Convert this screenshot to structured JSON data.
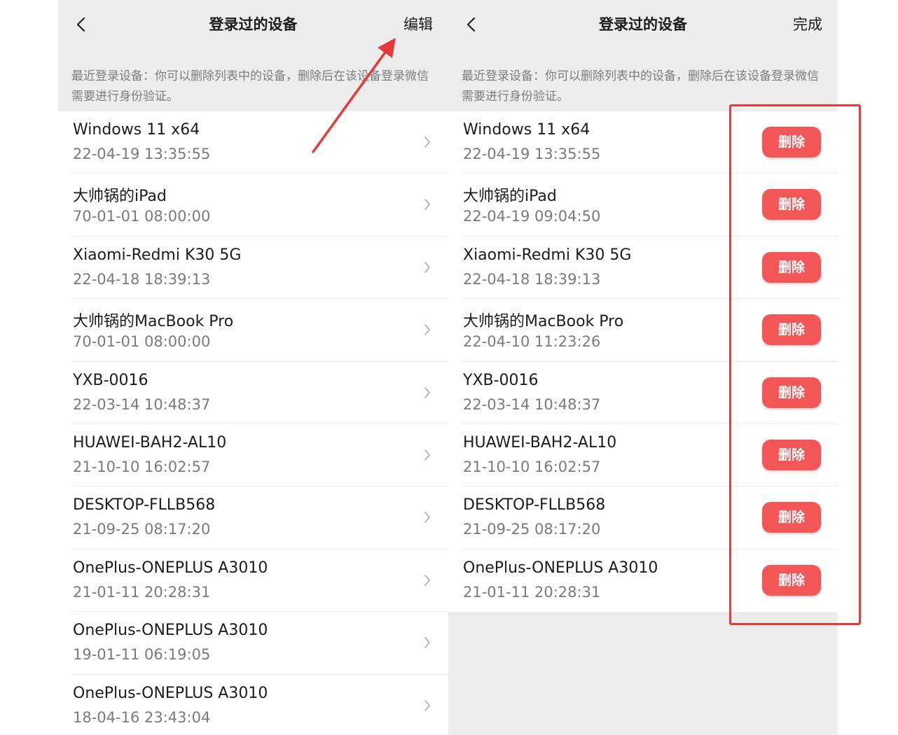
{
  "left": {
    "title": "登录过的设备",
    "action": "编辑",
    "info": "最近登录设备：你可以删除列表中的设备，删除后在该设备登录微信需要进行身份验证。",
    "devices": [
      {
        "name": "Windows 11 x64",
        "time": "22-04-19 13:35:55"
      },
      {
        "name": "大帅锅的iPad",
        "time": "70-01-01 08:00:00"
      },
      {
        "name": "Xiaomi-Redmi K30 5G",
        "time": "22-04-18 18:39:13"
      },
      {
        "name": "大帅锅的MacBook Pro",
        "time": "70-01-01 08:00:00"
      },
      {
        "name": "YXB-0016",
        "time": "22-03-14 10:48:37"
      },
      {
        "name": "HUAWEI-BAH2-AL10",
        "time": "21-10-10 16:02:57"
      },
      {
        "name": "DESKTOP-FLLB568",
        "time": "21-09-25 08:17:20"
      },
      {
        "name": "OnePlus-ONEPLUS A3010",
        "time": "21-01-11 20:28:31"
      },
      {
        "name": "OnePlus-ONEPLUS A3010",
        "time": "19-01-11 06:19:05"
      },
      {
        "name": "OnePlus-ONEPLUS A3010",
        "time": "18-04-16 23:43:04"
      }
    ]
  },
  "right": {
    "title": "登录过的设备",
    "action": "完成",
    "info": "最近登录设备：你可以删除列表中的设备，删除后在该设备登录微信需要进行身份验证。",
    "delete_label": "删除",
    "devices": [
      {
        "name": "Windows 11 x64",
        "time": "22-04-19 13:35:55"
      },
      {
        "name": "大帅锅的iPad",
        "time": "22-04-19 09:04:50"
      },
      {
        "name": "Xiaomi-Redmi K30 5G",
        "time": "22-04-18 18:39:13"
      },
      {
        "name": "大帅锅的MacBook Pro",
        "time": "22-04-10 11:23:26"
      },
      {
        "name": "YXB-0016",
        "time": "22-03-14 10:48:37"
      },
      {
        "name": "HUAWEI-BAH2-AL10",
        "time": "21-10-10 16:02:57"
      },
      {
        "name": "DESKTOP-FLLB568",
        "time": "21-09-25 08:17:20"
      },
      {
        "name": "OnePlus-ONEPLUS A3010",
        "time": "21-01-11 20:28:31"
      }
    ]
  },
  "icons": {
    "back": "chevron-left-icon",
    "row": "chevron-right-icon",
    "annotation": "red-arrow"
  },
  "colors": {
    "panel_background": "#ededed",
    "list_background": "#ffffff",
    "delete_button": "#f35656",
    "annotation_red": "#e63a3a",
    "secondary_text": "#7a7a7a"
  }
}
